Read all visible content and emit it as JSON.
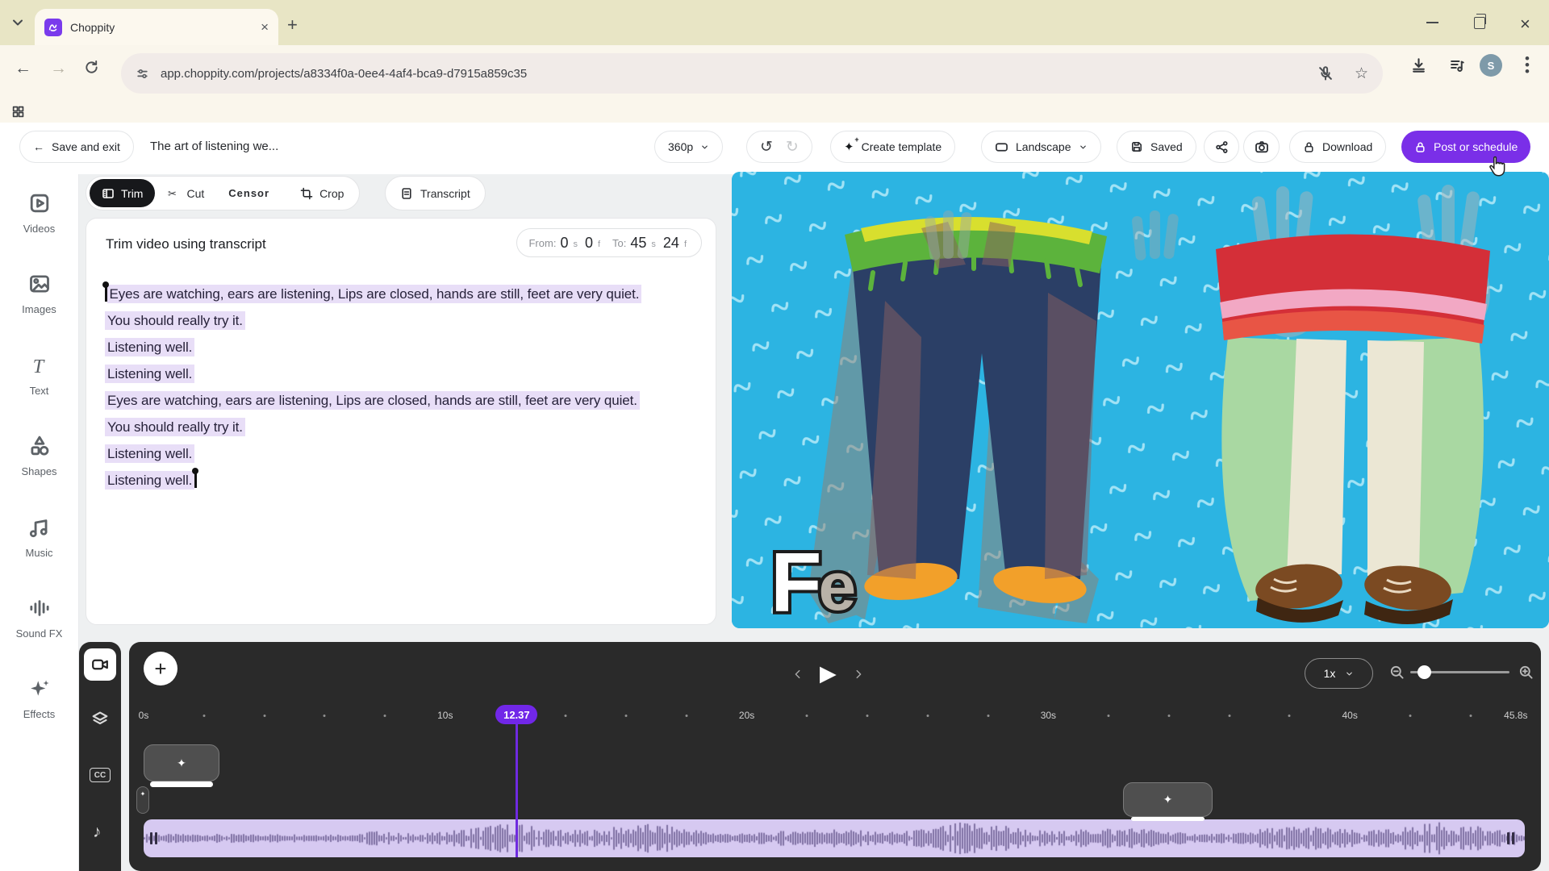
{
  "browser": {
    "tab_title": "Choppity",
    "url": "app.choppity.com/projects/a8334f0a-0ee4-4af4-bca9-d7915a859c35",
    "avatar_letter": "S"
  },
  "toolbar": {
    "save_exit_label": "Save and exit",
    "back_arrow": "←",
    "project_title": "The art of listening we...",
    "resolution": "360p",
    "undo_glyph": "↺",
    "redo_glyph": "↻",
    "create_template_label": "Create template",
    "orientation_label": "Landscape",
    "saved_label": "Saved",
    "download_label": "Download",
    "post_label": "Post or schedule"
  },
  "sidebar": {
    "items": [
      {
        "label": "Videos",
        "icon": "video-file"
      },
      {
        "label": "Images",
        "icon": "image"
      },
      {
        "label": "Text",
        "icon": "text"
      },
      {
        "label": "Shapes",
        "icon": "shapes"
      },
      {
        "label": "Music",
        "icon": "music"
      },
      {
        "label": "Sound FX",
        "icon": "soundfx"
      },
      {
        "label": "Effects",
        "icon": "effects"
      }
    ]
  },
  "editor": {
    "tabs": [
      {
        "label": "Trim",
        "icon": "film",
        "active": true
      },
      {
        "label": "Cut",
        "icon": "scissors",
        "active": false
      },
      {
        "label": "Censor",
        "icon": "censor",
        "active": false
      },
      {
        "label": "Crop",
        "icon": "crop",
        "active": false
      }
    ],
    "transcript_tab": "Transcript",
    "panel_title": "Trim video using transcript",
    "from_label": "From:",
    "from_s": "0",
    "from_s_unit": "s",
    "from_f": "0",
    "from_f_unit": "f",
    "to_label": "To:",
    "to_s": "45",
    "to_s_unit": "s",
    "to_f": "24",
    "to_f_unit": "f",
    "transcript_lines": [
      "Eyes are watching, ears are listening, Lips are closed, hands are still, feet are very quiet.",
      "You should really try it.",
      "Listening well.",
      "Listening well.",
      "Eyes are watching, ears are listening, Lips are closed, hands are still, feet are very quiet.",
      "You should really try it.",
      "Listening well.",
      "Listening well."
    ]
  },
  "preview": {
    "overlay_text": "Fe"
  },
  "timeline": {
    "speed": "1x",
    "playhead_label": "12.37",
    "playhead_seconds": 12.37,
    "duration_seconds": 45.8,
    "dot_step": 2,
    "ruler_labels": [
      {
        "t": 0,
        "label": "0s"
      },
      {
        "t": 10,
        "label": "10s"
      },
      {
        "t": 20,
        "label": "20s"
      },
      {
        "t": 30,
        "label": "30s"
      },
      {
        "t": 40,
        "label": "40s"
      },
      {
        "t": 45.8,
        "label": "45.8s"
      }
    ]
  },
  "colors": {
    "accent_purple": "#7a2fe8",
    "playhead_purple": "#7127e8",
    "transcript_highlight": "#e8def7",
    "timeline_bg": "#2a2a2a",
    "waveform_bg": "#d6c9f1",
    "waveform_fg": "#7f70a3",
    "preview_bg": "#2cb4e2",
    "tabstrip_bg": "#e8e5c5",
    "browser_toolbar_bg": "#faf6ec"
  }
}
